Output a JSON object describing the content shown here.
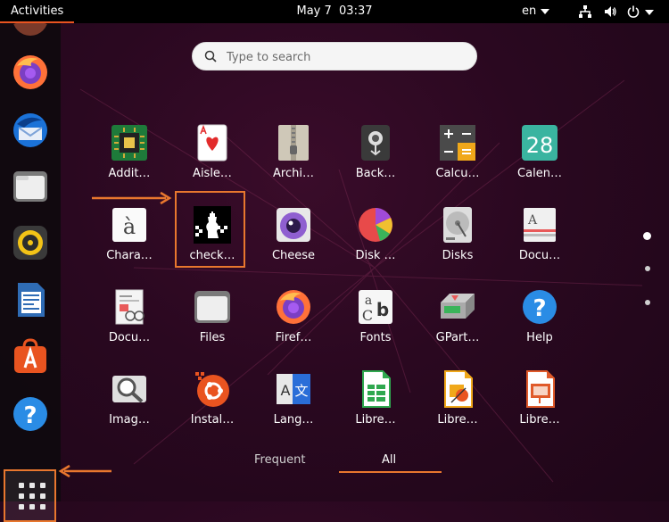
{
  "topbar": {
    "activities": "Activities",
    "date": "May 7",
    "time": "03:37",
    "language": "en"
  },
  "search": {
    "placeholder": "Type to search"
  },
  "apps": [
    {
      "label": "Addit…",
      "icon": "chip-icon"
    },
    {
      "label": "Aisle…",
      "icon": "playing-card-icon"
    },
    {
      "label": "Archi…",
      "icon": "archive-zipper-icon"
    },
    {
      "label": "Back…",
      "icon": "backup-safe-icon"
    },
    {
      "label": "Calcu…",
      "icon": "calculator-icon"
    },
    {
      "label": "Calen…",
      "icon": "calendar-icon"
    },
    {
      "label": "Chara…",
      "icon": "character-map-icon"
    },
    {
      "label": "check…",
      "icon": "chess-icon"
    },
    {
      "label": "Cheese",
      "icon": "webcam-icon"
    },
    {
      "label": "Disk …",
      "icon": "disk-usage-pie-icon"
    },
    {
      "label": "Disks",
      "icon": "hard-disk-icon"
    },
    {
      "label": "Docu…",
      "icon": "document-viewer-icon"
    },
    {
      "label": "Docu…",
      "icon": "document-scanner-icon"
    },
    {
      "label": "Files",
      "icon": "folder-icon"
    },
    {
      "label": "Firef…",
      "icon": "firefox-icon"
    },
    {
      "label": "Fonts",
      "icon": "fonts-icon"
    },
    {
      "label": "GPart…",
      "icon": "gparted-icon"
    },
    {
      "label": "Help",
      "icon": "help-icon"
    },
    {
      "label": "Imag…",
      "icon": "image-viewer-icon"
    },
    {
      "label": "Instal…",
      "icon": "ubuntu-installer-icon"
    },
    {
      "label": "Lang…",
      "icon": "language-support-icon"
    },
    {
      "label": "Libre…",
      "icon": "libreoffice-calc-icon"
    },
    {
      "label": "Libre…",
      "icon": "libreoffice-draw-icon"
    },
    {
      "label": "Libre…",
      "icon": "libreoffice-impress-icon"
    }
  ],
  "tabs": {
    "frequent": "Frequent",
    "all": "All"
  },
  "dock": [
    "firefox-icon",
    "thunderbird-icon",
    "files-icon",
    "rhythmbox-icon",
    "libreoffice-writer-icon",
    "software-center-icon",
    "help-icon",
    "show-applications-icon"
  ],
  "colors": {
    "accent": "#e95420",
    "highlight": "#e8772e",
    "topbar": "#000000"
  }
}
